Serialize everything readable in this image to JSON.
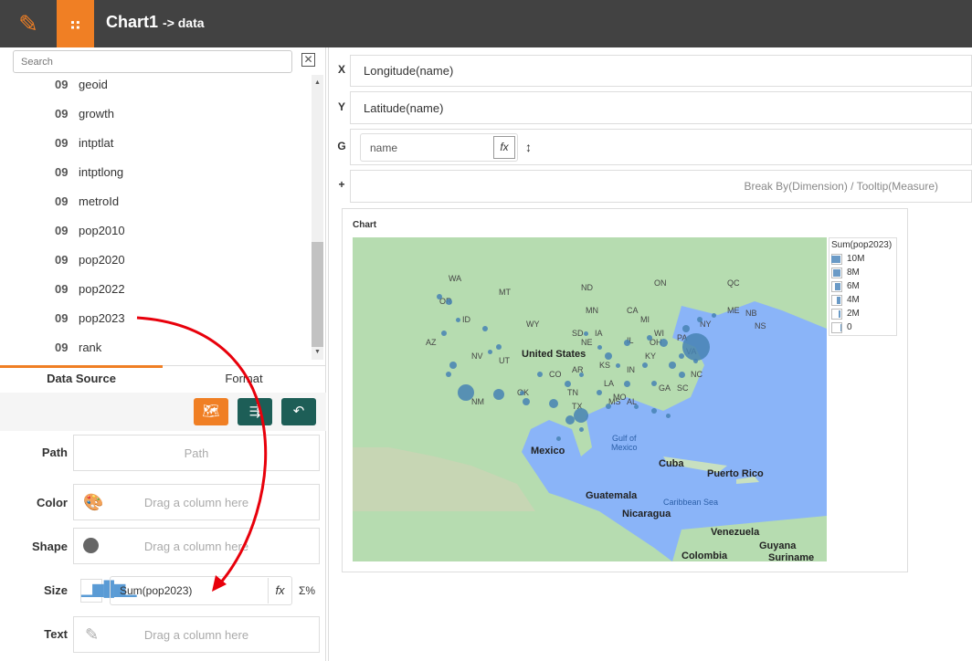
{
  "header": {
    "title": "Chart1",
    "subtitle": "-> data"
  },
  "search": {
    "placeholder": "Search"
  },
  "fields": [
    {
      "type": "09",
      "name": "geoid"
    },
    {
      "type": "09",
      "name": "growth"
    },
    {
      "type": "09",
      "name": "intptlat"
    },
    {
      "type": "09",
      "name": "intptlong"
    },
    {
      "type": "09",
      "name": "metroId"
    },
    {
      "type": "09",
      "name": "pop2010"
    },
    {
      "type": "09",
      "name": "pop2020"
    },
    {
      "type": "09",
      "name": "pop2022"
    },
    {
      "type": "09",
      "name": "pop2023"
    },
    {
      "type": "09",
      "name": "rank"
    }
  ],
  "tabs": [
    "Data Source",
    "Format"
  ],
  "props": {
    "path_label": "Path",
    "path_placeholder": "Path",
    "color_label": "Color",
    "color_placeholder": "Drag a column here",
    "shape_label": "Shape",
    "shape_placeholder": "Drag a column here",
    "size_label": "Size",
    "size_value": "Sum(pop2023)",
    "text_label": "Text",
    "text_placeholder": "Drag a column here"
  },
  "shelves": {
    "x_label": "X",
    "x_value": "Longitude(name)",
    "y_label": "Y",
    "y_value": "Latitude(name)",
    "g_label": "G",
    "g_value": "name",
    "plus_label": "+",
    "plus_placeholder": "Break By(Dimension) / Tooltip(Measure)"
  },
  "chart": {
    "title": "Chart",
    "map_labels": {
      "us": "United States",
      "mexico": "Mexico",
      "gulf": "Gulf of\nMexico",
      "cuba": "Cuba",
      "pr": "Puerto Rico",
      "guatemala": "Guatemala",
      "nicaragua": "Nicaragua",
      "caribbean": "Caribbean Sea",
      "venezuela": "Venezuela",
      "colombia": "Colombia",
      "guyana": "Guyana",
      "suriname": "Suriname",
      "states": [
        "NV",
        "UT",
        "CO",
        "KS",
        "MO",
        "TN",
        "TX",
        "MN",
        "NY",
        "ME",
        "NE",
        "IL",
        "OH",
        "NB",
        "NS",
        "ND",
        "MT",
        "ID",
        "OR",
        "WA",
        "WY",
        "SD",
        "IA",
        "IN",
        "KY",
        "VA",
        "NC",
        "SC",
        "GA",
        "AL",
        "MS",
        "LA",
        "AR",
        "OK",
        "NM",
        "AZ",
        "CA",
        "MI",
        "WI",
        "PA",
        "QC",
        "ON"
      ]
    },
    "legend": {
      "title": "Sum(pop2023)",
      "items": [
        "10M",
        "8M",
        "6M",
        "4M",
        "2M",
        "0"
      ]
    },
    "colors": {
      "map_water": "#8ab4f8",
      "land": "#b6dcb0",
      "bubble": "#4682b4"
    }
  },
  "colors": {
    "accent": "#f07f24",
    "header": "#424242",
    "teal": "#1d5e57"
  }
}
